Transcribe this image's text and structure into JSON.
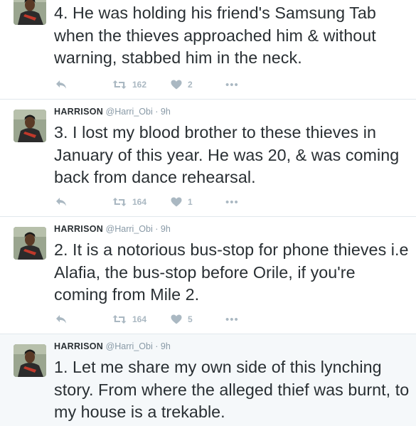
{
  "tweets": [
    {
      "text": "4. He was holding his friend's Samsung Tab when the thieves approached him & without warning, stabbed him in the neck.",
      "retweets": "162",
      "likes": "2"
    },
    {
      "name": "HARRISON",
      "handle": "@Harri_Obi",
      "time": "9h",
      "text": "3. I lost my blood brother to these thieves in January of this year. He was 20, & was coming back from dance rehearsal.",
      "retweets": "164",
      "likes": "1"
    },
    {
      "name": "HARRISON",
      "handle": "@Harri_Obi",
      "time": "9h",
      "text": "2. It is a notorious bus-stop for phone thieves i.e Alafia, the bus-stop before Orile, if you're coming from Mile 2.",
      "retweets": "164",
      "likes": "5"
    },
    {
      "name": "HARRISON",
      "handle": "@Harri_Obi",
      "time": "9h",
      "text": "1. Let me share my own side of this lynching story. From where the alleged thief was burnt, to my house is a trekable."
    }
  ],
  "separator": "·",
  "more_glyph": "•••",
  "icons": {
    "reply": "reply-icon",
    "retweet": "retweet-icon",
    "like": "heart-icon",
    "more": "more-icon"
  },
  "colors": {
    "text": "#292f33",
    "muted": "#8899a6",
    "icon": "#aab8c2",
    "highlight_bg": "#f5f8fa",
    "border": "#e1e8ed"
  }
}
